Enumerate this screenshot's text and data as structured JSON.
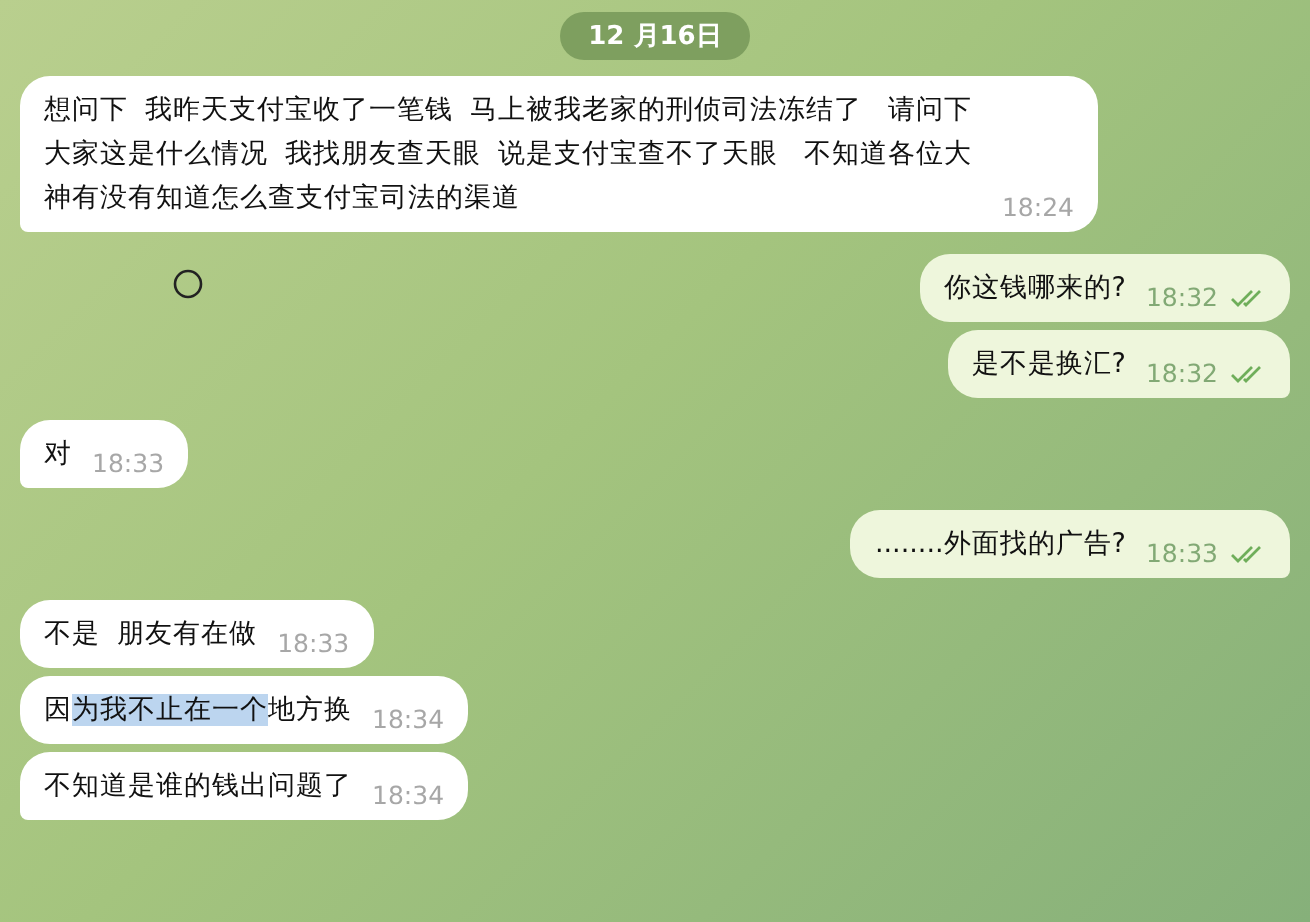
{
  "date_badge": "12 月16日",
  "messages": [
    {
      "outgoing": false,
      "parts": [
        {
          "text": "想问下  我昨天支付宝收了一笔钱  马上被我老家的刑侦司法冻结了   请问下大家这是什么情况  我找朋友查天眼  说是支付宝查不了天眼   不知道各位大神有没有知道怎么查支付宝司法的渠道",
          "selected": false
        }
      ],
      "time": "18:24"
    },
    {
      "outgoing": true,
      "parts": [
        {
          "text": "你这钱哪来的?",
          "selected": false
        }
      ],
      "time": "18:32",
      "read": true
    },
    {
      "outgoing": true,
      "parts": [
        {
          "text": "是不是换汇?",
          "selected": false
        }
      ],
      "time": "18:32",
      "read": true
    },
    {
      "outgoing": false,
      "parts": [
        {
          "text": "对",
          "selected": false
        }
      ],
      "time": "18:33"
    },
    {
      "outgoing": true,
      "parts": [
        {
          "text": "........外面找的广告?",
          "selected": false
        }
      ],
      "time": "18:33",
      "read": true
    },
    {
      "outgoing": false,
      "parts": [
        {
          "text": "不是  朋友有在做",
          "selected": false
        }
      ],
      "time": "18:33"
    },
    {
      "outgoing": false,
      "parts": [
        {
          "text": "因",
          "selected": false
        },
        {
          "text": "为我不止在一个",
          "selected": true
        },
        {
          "text": "地方换",
          "selected": false
        }
      ],
      "time": "18:34"
    },
    {
      "outgoing": false,
      "parts": [
        {
          "text": "不知道是谁的钱出问题了",
          "selected": false
        }
      ],
      "time": "18:34"
    }
  ]
}
